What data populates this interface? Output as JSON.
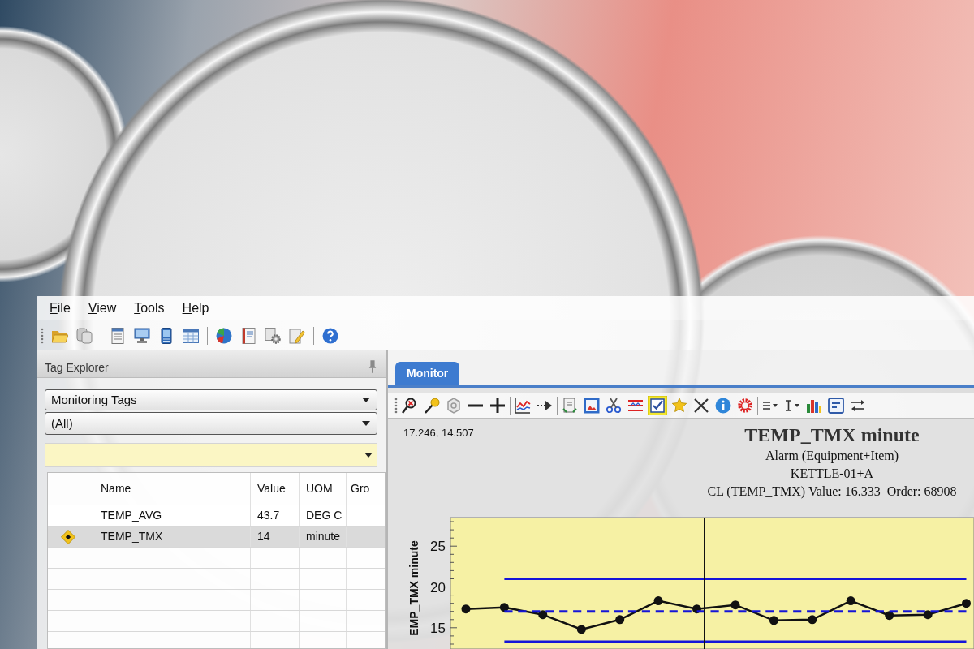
{
  "menu": [
    "File",
    "View",
    "Tools",
    "Help"
  ],
  "tag_explorer": {
    "title": "Tag Explorer",
    "tag_set": "Monitoring Tags",
    "tag_filter": "(All)",
    "table": {
      "columns": [
        "Name",
        "Value",
        "UOM",
        "Gro"
      ],
      "rows": [
        {
          "cells": [
            "TEMP_AVG",
            "43.7",
            "DEG C"
          ],
          "alarm": false,
          "selected": false
        },
        {
          "cells": [
            "TEMP_TMX",
            "14",
            "minute"
          ],
          "alarm": true,
          "selected": true
        }
      ]
    }
  },
  "monitor": {
    "tabs": [
      {
        "label": "Monitor",
        "selected": true
      }
    ],
    "toolbar": [
      {
        "selected": false
      },
      {
        "selected": false
      },
      {
        "selected": false
      },
      {
        "selected": false
      },
      {
        "selected": false
      },
      {
        "selected": false
      },
      {
        "selected": false
      },
      {
        "selected": false
      },
      {
        "selected": false
      },
      {
        "selected": false
      },
      {
        "selected": false
      },
      {
        "selected": true
      },
      {
        "selected": false
      },
      {
        "selected": false
      },
      {
        "selected": false
      },
      {
        "selected": false
      },
      {
        "selected": false
      },
      {
        "selected": false
      },
      {
        "selected": false
      },
      {
        "selected": false
      },
      {
        "selected": false
      }
    ],
    "cursor_readout": "17.246, 14.507",
    "chart_title": "TEMP_TMX minute",
    "chart_subtitles": [
      "Alarm (Equipment+Item)",
      "KETTLE-01+A",
      "CL (TEMP_TMX) Value: 16.333  Order: 68908"
    ],
    "chart_data": {
      "type": "line",
      "ylabel": "EMP_TMX minute",
      "categories": [
        null,
        null,
        null,
        null,
        null,
        null,
        null,
        null,
        null,
        null,
        null,
        null,
        null,
        null
      ],
      "ylim": [
        12.4,
        28.5
      ],
      "yticks": [
        15,
        20,
        25
      ],
      "series": [
        {
          "color": "#111111",
          "marker": "circle",
          "values": [
            17.3,
            17.5,
            16.6,
            14.8,
            16.0,
            18.3,
            17.3,
            17.8,
            15.9,
            16.0,
            18.3,
            16.5,
            16.6,
            18.0
          ]
        },
        {
          "color": "#1414d8",
          "values": [
            null,
            21,
            21,
            21,
            21,
            21,
            21,
            21,
            21,
            21,
            21,
            21,
            21,
            21
          ]
        },
        {
          "color": "#1414d8",
          "line_style": "dashed",
          "values": [
            null,
            17.0,
            17.0,
            17.0,
            17.0,
            17.0,
            17.0,
            17.0,
            17.0,
            17.0,
            17.0,
            17.0,
            17.0,
            17.0
          ]
        },
        {
          "color": "#1414d8",
          "values": [
            null,
            13.3,
            13.3,
            13.3,
            13.3,
            13.3,
            13.3,
            13.3,
            13.3,
            13.3,
            13.3,
            13.3,
            13.3,
            13.3
          ]
        }
      ]
    }
  }
}
